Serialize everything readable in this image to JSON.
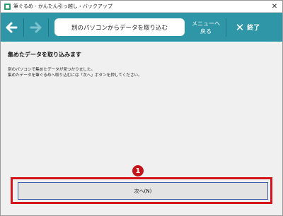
{
  "window": {
    "title": "筆ぐるめ - かんたん引っ越し・バックアップ",
    "close_glyph": "✕"
  },
  "toolbar": {
    "back_icon": "arrow-left-icon",
    "forward_icon": "arrow-right-icon",
    "page_title": "別のパソコンからデータを取り込む",
    "menu_label_line1": "メニューへ",
    "menu_label_line2": "戻る",
    "end_label": "終了",
    "end_glyph": "✕",
    "color": "#2f96a8"
  },
  "main": {
    "heading": "集めたデータを取り込みます",
    "body_line1": "別のパソコンで集めたデータが見つかりました。",
    "body_line2": "集めたデータを筆ぐるめへ取り込むには「次へ」ボタンを押してください。"
  },
  "callout": {
    "number": "1",
    "color": "#d4151c"
  },
  "next_button": {
    "label": "次へ(N)"
  }
}
